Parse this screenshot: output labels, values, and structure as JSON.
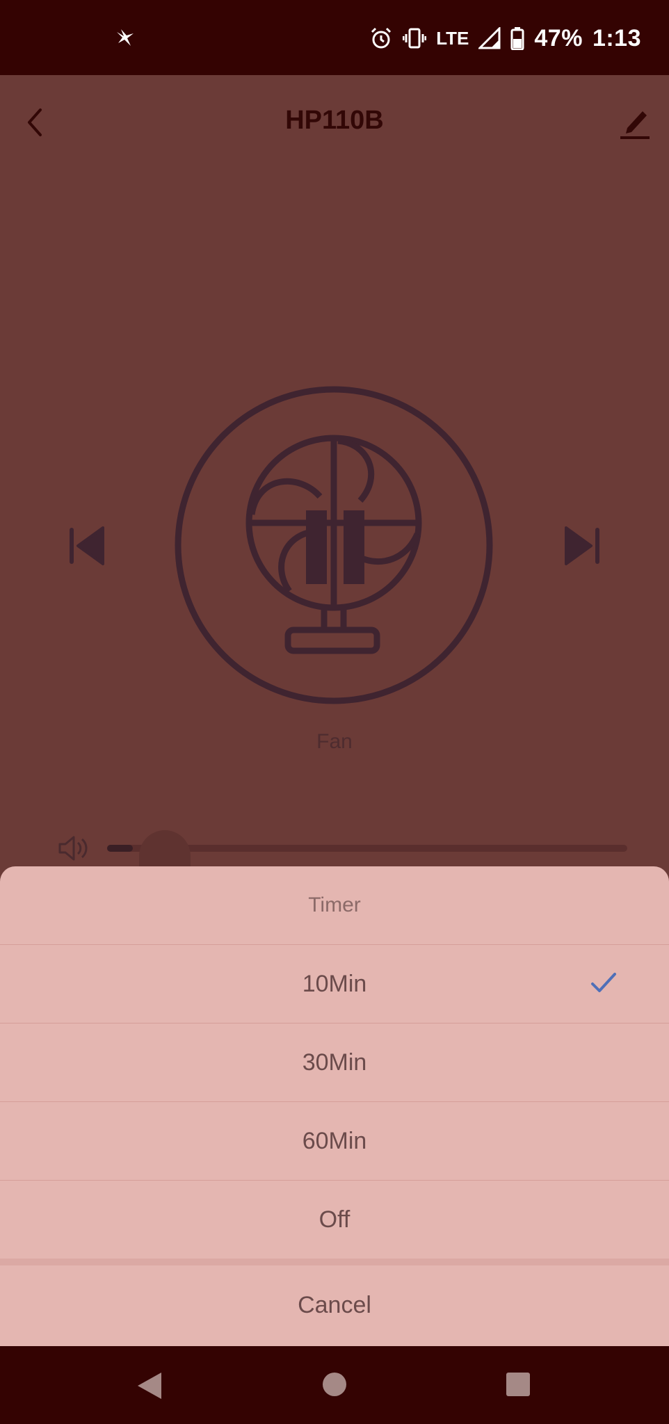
{
  "status_bar": {
    "battery": "47%",
    "time": "1:13",
    "network": "LTE",
    "icons": [
      "notification-bird-icon",
      "alarm-icon",
      "vibrate-icon",
      "signal-icon",
      "battery-icon"
    ]
  },
  "header": {
    "title": "HP110B",
    "icons": [
      "back-chevron-icon",
      "edit-pencil-icon"
    ]
  },
  "control": {
    "mode_label": "Fan",
    "volume_level_fraction": 0.05,
    "icons": [
      "previous-mode-icon",
      "fan-icon",
      "next-mode-icon",
      "volume-icon"
    ]
  },
  "timer_sheet": {
    "title": "Timer",
    "options": [
      {
        "label": "10Min",
        "selected": true
      },
      {
        "label": "30Min",
        "selected": false
      },
      {
        "label": "60Min",
        "selected": false
      },
      {
        "label": "Off",
        "selected": false
      }
    ],
    "cancel_label": "Cancel",
    "check_color": "#4f6fb8"
  },
  "nav_bar": {
    "icons": [
      "nav-back-icon",
      "nav-home-icon",
      "nav-recents-icon"
    ]
  },
  "colors": {
    "status_bar_bg": "#340302",
    "dimmed_background": "#6b3b37",
    "sheet_bg": "#e4b6b1",
    "sheet_text": "#6b4b4b"
  }
}
